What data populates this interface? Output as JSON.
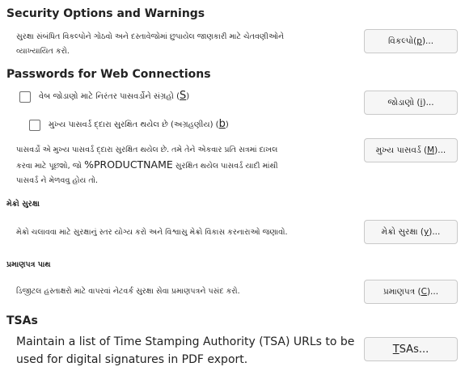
{
  "security": {
    "title": "Security Options and Warnings",
    "desc_line1": "સુરક્ષા સંબંધિત વિકલ્પોને ગોઠવો અને દસ્તાવેજોમાં છુપાયેલ જાણકારી માટે ચેતવણીઓને",
    "desc_line2": "વ્યાખ્યાયિત કરો.",
    "button_text": "વિકલ્પો(",
    "button_key": "p",
    "button_tail": ")..."
  },
  "passwords": {
    "title": "Passwords for Web Connections",
    "persist_label": "વેબ જોડાણો માટે નિરંતર પાસવર્ડોને સંગ્રહો (",
    "persist_key": "S",
    "persist_tail": ")",
    "persist_checked": false,
    "master_label": "મુખ્ય પાસવર્ડ દ્દારા સુરક્ષિત થયેલ છે (અગ્રહણીય) (",
    "master_key": "b",
    "master_tail": ")",
    "master_checked": false,
    "connections_button_text": "જોડાણો (",
    "connections_button_key": "i",
    "connections_button_tail": ")...",
    "info_line1": "પાસવર્ડો એ મુખ્ય પાસવર્ડ દ્દારા સુરક્ષિત થયેલ છે. તમે તેને એકવાર પ્રતિ સત્રમાં દાખલ",
    "info_line2_a": "કરવા માટે પૂછશો, જો ",
    "info_line2_b": "%PRODUCTNAME",
    "info_line2_c": " સુરક્ષિત થયેલ પાસવર્ડ યાદી માંથી",
    "info_line3": "પાસવર્ડ ને મેળવવુ હોય તો.",
    "master_button_text": "મુખ્ય પાસવર્ડ (",
    "master_button_key": "M",
    "master_button_tail": ")..."
  },
  "macro": {
    "title": "મેક્રો સુરક્ષા",
    "desc": "મેક્રો ચલાવવા માટે સુરક્ષાનું સ્તર યોગ્ય કરો અને વિશ્વાસુ મેક્રો વિકાસ કરનારાઓ જણાવો.",
    "button_text": "મેક્રો સુરક્ષા (",
    "button_key": "y",
    "button_tail": ")..."
  },
  "certificate": {
    "title": "પ્રમાણપત્ર પાથ",
    "desc": "ડિજીટલ હસ્તાક્ષરો માટે વાપરવાં નેટવર્ક સુરક્ષા સેવા પ્રમાણપત્રને પસંદ કરો.",
    "button_text": "પ્રમાણપત્ર (",
    "button_key": "C",
    "button_tail": ")..."
  },
  "tsa": {
    "title": "TSAs",
    "desc_line1": "Maintain a list of Time Stamping Authority (TSA) URLs to be",
    "desc_line2": "used for digital signatures in PDF export.",
    "button_key": "T",
    "button_tail": "SAs..."
  }
}
